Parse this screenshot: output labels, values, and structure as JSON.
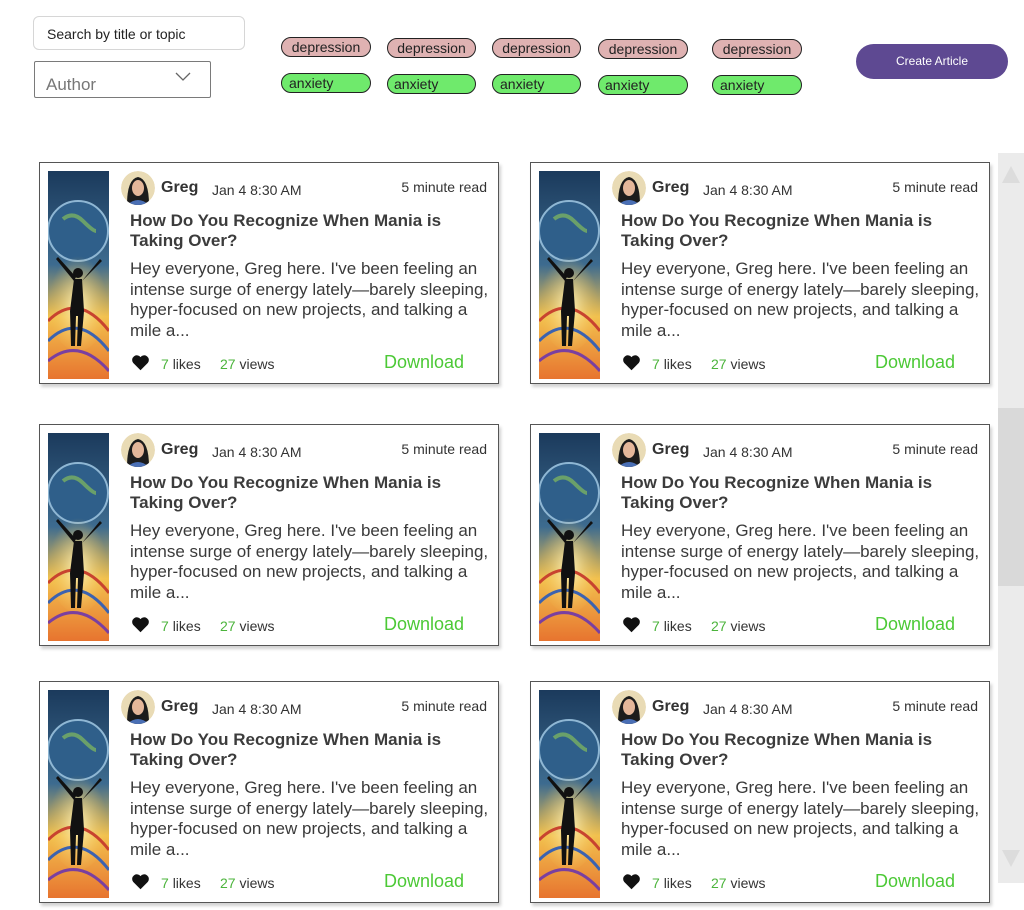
{
  "filters": {
    "search_placeholder": "Search by title or topic",
    "author_placeholder": "Author"
  },
  "tags": {
    "depression": [
      "depression",
      "depression",
      "depression",
      "depression",
      "depression"
    ],
    "anxiety": [
      "anxiety",
      "anxiety",
      "anxiety",
      "anxiety",
      "anxiety"
    ]
  },
  "create_label": "Create Article",
  "articles": [
    {
      "author": "Greg",
      "date": "Jan 4 8:30 AM",
      "read": "5 minute read",
      "title": "How Do You Recognize When Mania is Taking Over?",
      "excerpt": "Hey everyone, Greg here. I've been feeling an intense surge of energy lately—barely sleeping, hyper-focused on new projects, and talking a mile a...",
      "likes": "7",
      "likes_label": "likes",
      "views": "27",
      "views_label": "views",
      "download": "Download"
    },
    {
      "author": "Greg",
      "date": "Jan 4 8:30 AM",
      "read": "5 minute read",
      "title": "How Do You Recognize When Mania is Taking Over?",
      "excerpt": "Hey everyone, Greg here. I've been feeling an intense surge of energy lately—barely sleeping, hyper-focused on new projects, and talking a mile a...",
      "likes": "7",
      "likes_label": "likes",
      "views": "27",
      "views_label": "views",
      "download": "Download"
    },
    {
      "author": "Greg",
      "date": "Jan 4 8:30 AM",
      "read": "5 minute read",
      "title": "How Do You Recognize When Mania is Taking Over?",
      "excerpt": "Hey everyone, Greg here. I've been feeling an intense surge of energy lately—barely sleeping, hyper-focused on new projects, and talking a mile a...",
      "likes": "7",
      "likes_label": "likes",
      "views": "27",
      "views_label": "views",
      "download": "Download"
    },
    {
      "author": "Greg",
      "date": "Jan 4 8:30 AM",
      "read": "5 minute read",
      "title": "How Do You Recognize When Mania is Taking Over?",
      "excerpt": "Hey everyone, Greg here. I've been feeling an intense surge of energy lately—barely sleeping, hyper-focused on new projects, and talking a mile a...",
      "likes": "7",
      "likes_label": "likes",
      "views": "27",
      "views_label": "views",
      "download": "Download"
    },
    {
      "author": "Greg",
      "date": "Jan 4 8:30 AM",
      "read": "5 minute read",
      "title": "How Do You Recognize When Mania is Taking Over?",
      "excerpt": "Hey everyone, Greg here. I've been feeling an intense surge of energy lately—barely sleeping, hyper-focused on new projects, and talking a mile a...",
      "likes": "7",
      "likes_label": "likes",
      "views": "27",
      "views_label": "views",
      "download": "Download"
    },
    {
      "author": "Greg",
      "date": "Jan 4 8:30 AM",
      "read": "5 minute read",
      "title": "How Do You Recognize When Mania is Taking Over?",
      "excerpt": "Hey everyone, Greg here. I've been feeling an intense surge of energy lately—barely sleeping, hyper-focused on new projects, and talking a mile a...",
      "likes": "7",
      "likes_label": "likes",
      "views": "27",
      "views_label": "views",
      "download": "Download"
    }
  ],
  "colors": {
    "accent": "#5e4992",
    "depression_tag": "#dfb2b2",
    "anxiety_tag": "#6fea6c",
    "download": "#4cc936",
    "count": "#4cb43c"
  },
  "icons": [
    "chevron-down-icon",
    "heart-icon",
    "scroll-up-arrow-icon",
    "scroll-down-arrow-icon"
  ]
}
